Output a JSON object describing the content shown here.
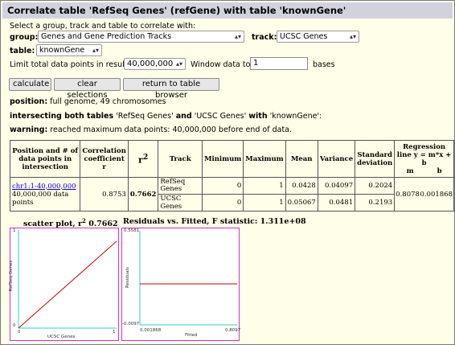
{
  "title": "Correlate table 'RefSeq Genes' (refGene) with table 'knownGene'",
  "intro": "Select a group, track and table to correlate with:",
  "group": {
    "label": "group:",
    "value": "Genes and Gene Prediction Tracks"
  },
  "track": {
    "label": "track:",
    "value": "UCSC Genes"
  },
  "table": {
    "label": "table:",
    "value": "knownGene"
  },
  "limit": {
    "label": "Limit total data points in result:",
    "value": "40,000,000"
  },
  "window": {
    "label": "Window data to:",
    "value": "1",
    "unit": "bases"
  },
  "buttons": {
    "calculate": "calculate",
    "clear": "clear selections",
    "return": "return to table browser"
  },
  "info": {
    "position_label": "position:",
    "position_value": "full genome, 49 chromosomes",
    "intersect_bold1": "intersecting both tables",
    "intersect_q1": " 'RefSeq Genes' ",
    "intersect_and": "and",
    "intersect_q2": " 'UCSC Genes' ",
    "intersect_with": "with",
    "intersect_tail": " 'knownGene':",
    "warning_label": "warning:",
    "warning_value": "reached maximum data points: 40,000,000 before end of data."
  },
  "result_table": {
    "headers": {
      "position": "Position and # of data points in intersection",
      "correlation": "Correlation coefficient r",
      "r2": "r",
      "r2_sup": "2",
      "track": "Track",
      "minimum": "Minimum",
      "maximum": "Maximum",
      "mean": "Mean",
      "variance": "Variance",
      "stddev": "Standard deviation",
      "regression": "Regression line y = m*x + b",
      "m": "m",
      "b": "b"
    },
    "position_link": "chr1:1-40,000,000",
    "datapoints": "40,000,000 data points",
    "correlation": "0.8753",
    "r2": "0.7662",
    "rows": [
      {
        "track": "RefSeq Genes",
        "minimum": "0",
        "maximum": "1",
        "mean": "0.0428",
        "variance": "0.04097",
        "stddev": "0.2024"
      },
      {
        "track": "UCSC Genes",
        "minimum": "0",
        "maximum": "1",
        "mean": "0.05067",
        "variance": "0.0481",
        "stddev": "0.2193"
      }
    ],
    "m": "0.8078",
    "b": "0.001868"
  },
  "scatter": {
    "title": "scatter plot, r",
    "title_sup": "2",
    "title_value": "0.7662",
    "ylabel": "RefSeq Genes",
    "xlabel": "UCSC Genes",
    "y_top": "1",
    "y_bottom": "0",
    "x_left": "0",
    "x_right": "1"
  },
  "residuals": {
    "title": "Residuals vs. Fitted, F statistic: 1.311e+08",
    "ylabel": "Residuals",
    "xlabel": "Fitted",
    "y_top": "0.5581",
    "y_bottom": "-0.0097",
    "x_left": "0.001868",
    "x_right": "0.8097"
  },
  "colors": {
    "background": "#fffee8",
    "titlebar": "#d2d2de",
    "plot_border": "#cc33cc",
    "axis": "#33cccc",
    "line": "#cc0000",
    "link": "#0000cc"
  }
}
